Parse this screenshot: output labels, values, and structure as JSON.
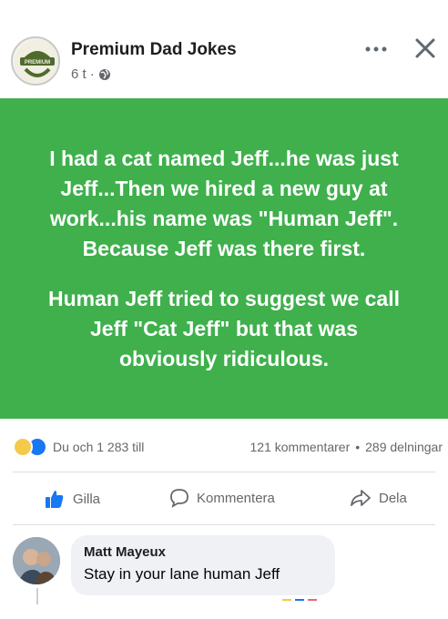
{
  "header": {
    "page_name": "Premium Dad Jokes",
    "time": "6 t",
    "separator": "·",
    "avatar_text": "PREMIUM"
  },
  "post": {
    "paragraphs": [
      "I had a cat named Jeff...he was just\nJeff...Then we hired a new guy at\nwork...his name was \"Human Jeff\".\nBecause Jeff was there first.",
      "Human Jeff tried to suggest we call\nJeff \"Cat Jeff\" but that was\nobviously ridiculous."
    ],
    "background_color": "#3fb04c"
  },
  "stats": {
    "reactions_text": "Du och 1 283 till",
    "comments": "121 kommentarer",
    "dot": "•",
    "shares": "289 delningar"
  },
  "actions": {
    "like": "Gilla",
    "comment": "Kommentera",
    "share": "Dela"
  },
  "comment": {
    "author": "Matt Mayeux",
    "text": "Stay in your lane human Jeff"
  },
  "icons": {
    "more": "more-options-icon",
    "close": "close-icon",
    "globe": "globe-icon",
    "like": "thumbs-up-icon",
    "comment": "comment-bubble-icon",
    "share": "share-arrow-icon"
  }
}
